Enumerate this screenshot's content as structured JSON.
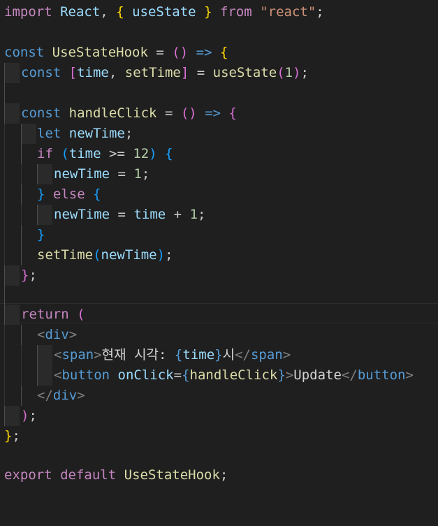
{
  "editor": {
    "language": "javascript-react",
    "theme_colors": {
      "background": "#1f1f1f",
      "keyword_control": "#c586c0",
      "keyword_storage": "#569cd6",
      "variable": "#9cdcfe",
      "function": "#dcdcaa",
      "component": "#4ec9b0",
      "string": "#ce9178",
      "number": "#b5cea8",
      "bracket_1": "#ffd700",
      "bracket_2": "#da70d6",
      "bracket_3": "#179fff"
    },
    "lines": {
      "l1": {
        "import": "import",
        "react_default": "React",
        "comma": ",",
        "use_state": "useState",
        "from": "from",
        "module": "\"react\"",
        "semi": ";"
      },
      "l3": {
        "const": "const",
        "name": "UseStateHook",
        "eq": "=",
        "arrow": "=>"
      },
      "l4": {
        "const": "const",
        "time": "time",
        "comma": ",",
        "set_time": "setTime",
        "eq": "=",
        "use_state": "useState",
        "init": "1",
        "semi": ";"
      },
      "l6": {
        "const": "const",
        "name": "handleClick",
        "eq": "=",
        "arrow": "=>"
      },
      "l7": {
        "let": "let",
        "new_time": "newTime",
        "semi": ";"
      },
      "l8": {
        "if": "if",
        "time": "time",
        "op": ">=",
        "num": "12"
      },
      "l9": {
        "new_time": "newTime",
        "eq": "=",
        "num": "1",
        "semi": ";"
      },
      "l10": {
        "else": "else"
      },
      "l11": {
        "new_time": "newTime",
        "eq": "=",
        "time": "time",
        "plus": "+",
        "num": "1",
        "semi": ";"
      },
      "l13": {
        "set_time": "setTime",
        "new_time": "newTime",
        "semi": ";"
      },
      "l14": {
        "semi": ";"
      },
      "l16": {
        "return": "return"
      },
      "l17": {
        "tag": "div"
      },
      "l18": {
        "tag_open": "span",
        "text_before": "현재 시각: ",
        "time": "time",
        "text_after": "시",
        "tag_close": "span"
      },
      "l19": {
        "tag_open": "button",
        "attr": "onClick",
        "handler": "handleClick",
        "text": "Update",
        "tag_close": "button"
      },
      "l20": {
        "tag": "div"
      },
      "l21": {
        "semi": ";"
      },
      "l22": {
        "semi": ";"
      },
      "l24": {
        "export": "export",
        "default": "default",
        "name": "UseStateHook",
        "semi": ";"
      }
    }
  }
}
